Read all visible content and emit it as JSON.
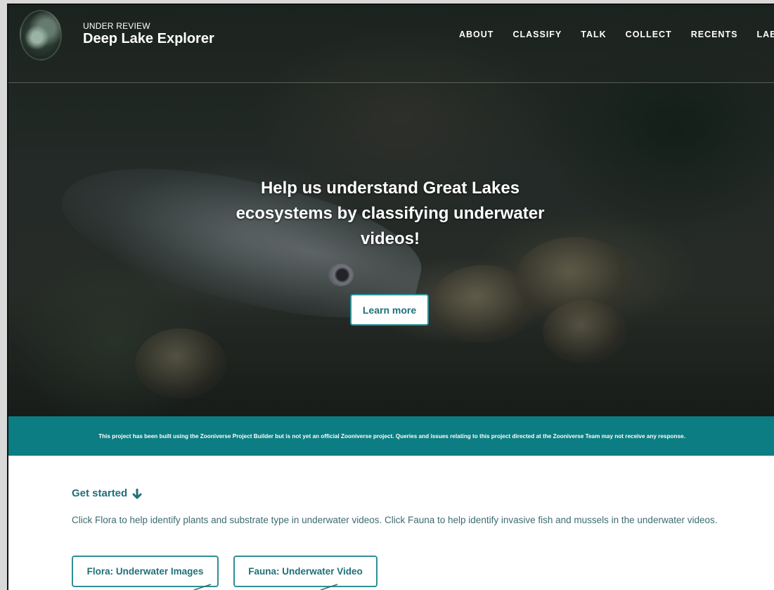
{
  "header": {
    "status_label": "UNDER REVIEW",
    "project_title": "Deep Lake Explorer",
    "nav": [
      "ABOUT",
      "CLASSIFY",
      "TALK",
      "COLLECT",
      "RECENTS",
      "LAB"
    ]
  },
  "hero": {
    "heading": "Help us understand Great Lakes ecosystems by classifying underwater videos!",
    "learn_more_label": "Learn more"
  },
  "banner": {
    "text": "This project has been built using the Zooniverse Project Builder but is not yet an official Zooniverse project. Queries and issues relating to this project directed at the Zooniverse Team may not receive any response."
  },
  "get_started": {
    "heading": "Get started",
    "icon": "arrow-down-icon",
    "description": "Click Flora to help identify plants and substrate type in underwater videos. Click Fauna to help identify invasive fish and mussels in the underwater videos.",
    "workflows": [
      "Flora: Underwater Images",
      "Fauna: Underwater Video"
    ]
  },
  "colors": {
    "teal_banner": "#0c7d82",
    "teal_text": "#1f7078",
    "button_border": "#2f8f96"
  }
}
